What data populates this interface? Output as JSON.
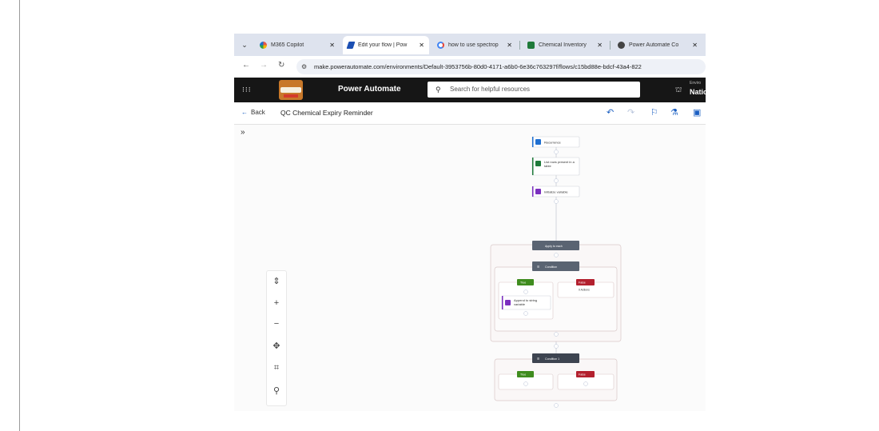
{
  "browser": {
    "tabs": [
      {
        "title": "M365 Copilot",
        "color": "#e2574c"
      },
      {
        "title": "Edit your flow | Pow",
        "color": "#1b4fb3",
        "active": true
      },
      {
        "title": "how to use spectrop",
        "color": "#4285f4"
      },
      {
        "title": "Chemical Inventory",
        "color": "#1f7a3a"
      },
      {
        "title": "Power Automate Co",
        "color": "#444444"
      }
    ],
    "url": "make.powerautomate.com/environments/Default-3953756b-80d0-4171-a6b0-6e36c763297f/flows/c15bd88e-bdcf-43a4-822"
  },
  "header": {
    "app_title": "Power Automate",
    "search_placeholder": "Search for helpful resources",
    "env_label": "Enviro",
    "env_value": "Natio"
  },
  "command_bar": {
    "back_label": "Back",
    "flow_name": "QC Chemical Expiry Reminder"
  },
  "flow": {
    "nodes": {
      "recurrence": "Recurrence",
      "list_rows_1": "List rows present in a",
      "list_rows_2": "table",
      "initialize": "Initialize variable",
      "apply_to_each": "Apply to each",
      "condition": "Condition",
      "true_label": "True",
      "false_label": "False",
      "append_1": "Append to string",
      "append_2": "variable",
      "false_actions": "0 Actions",
      "condition1": "Condition 1",
      "true_label_2": "True",
      "false_label_2": "False"
    },
    "colors": {
      "recurrence": "#1f6fd1",
      "excel": "#1f7a3a",
      "variable": "#7b2fbf",
      "control": "#5a6472",
      "true": "#3f8c1e",
      "false": "#b3202e"
    }
  },
  "icons": [
    "waffle-icon",
    "search-icon",
    "back-arrow-icon",
    "undo-icon",
    "redo-icon",
    "flow-checker-icon",
    "test-icon",
    "save-icon",
    "zoom-fit-icon",
    "zoom-in-icon",
    "zoom-out-icon",
    "pan-icon",
    "minimap-icon",
    "find-icon",
    "expand-icon"
  ]
}
